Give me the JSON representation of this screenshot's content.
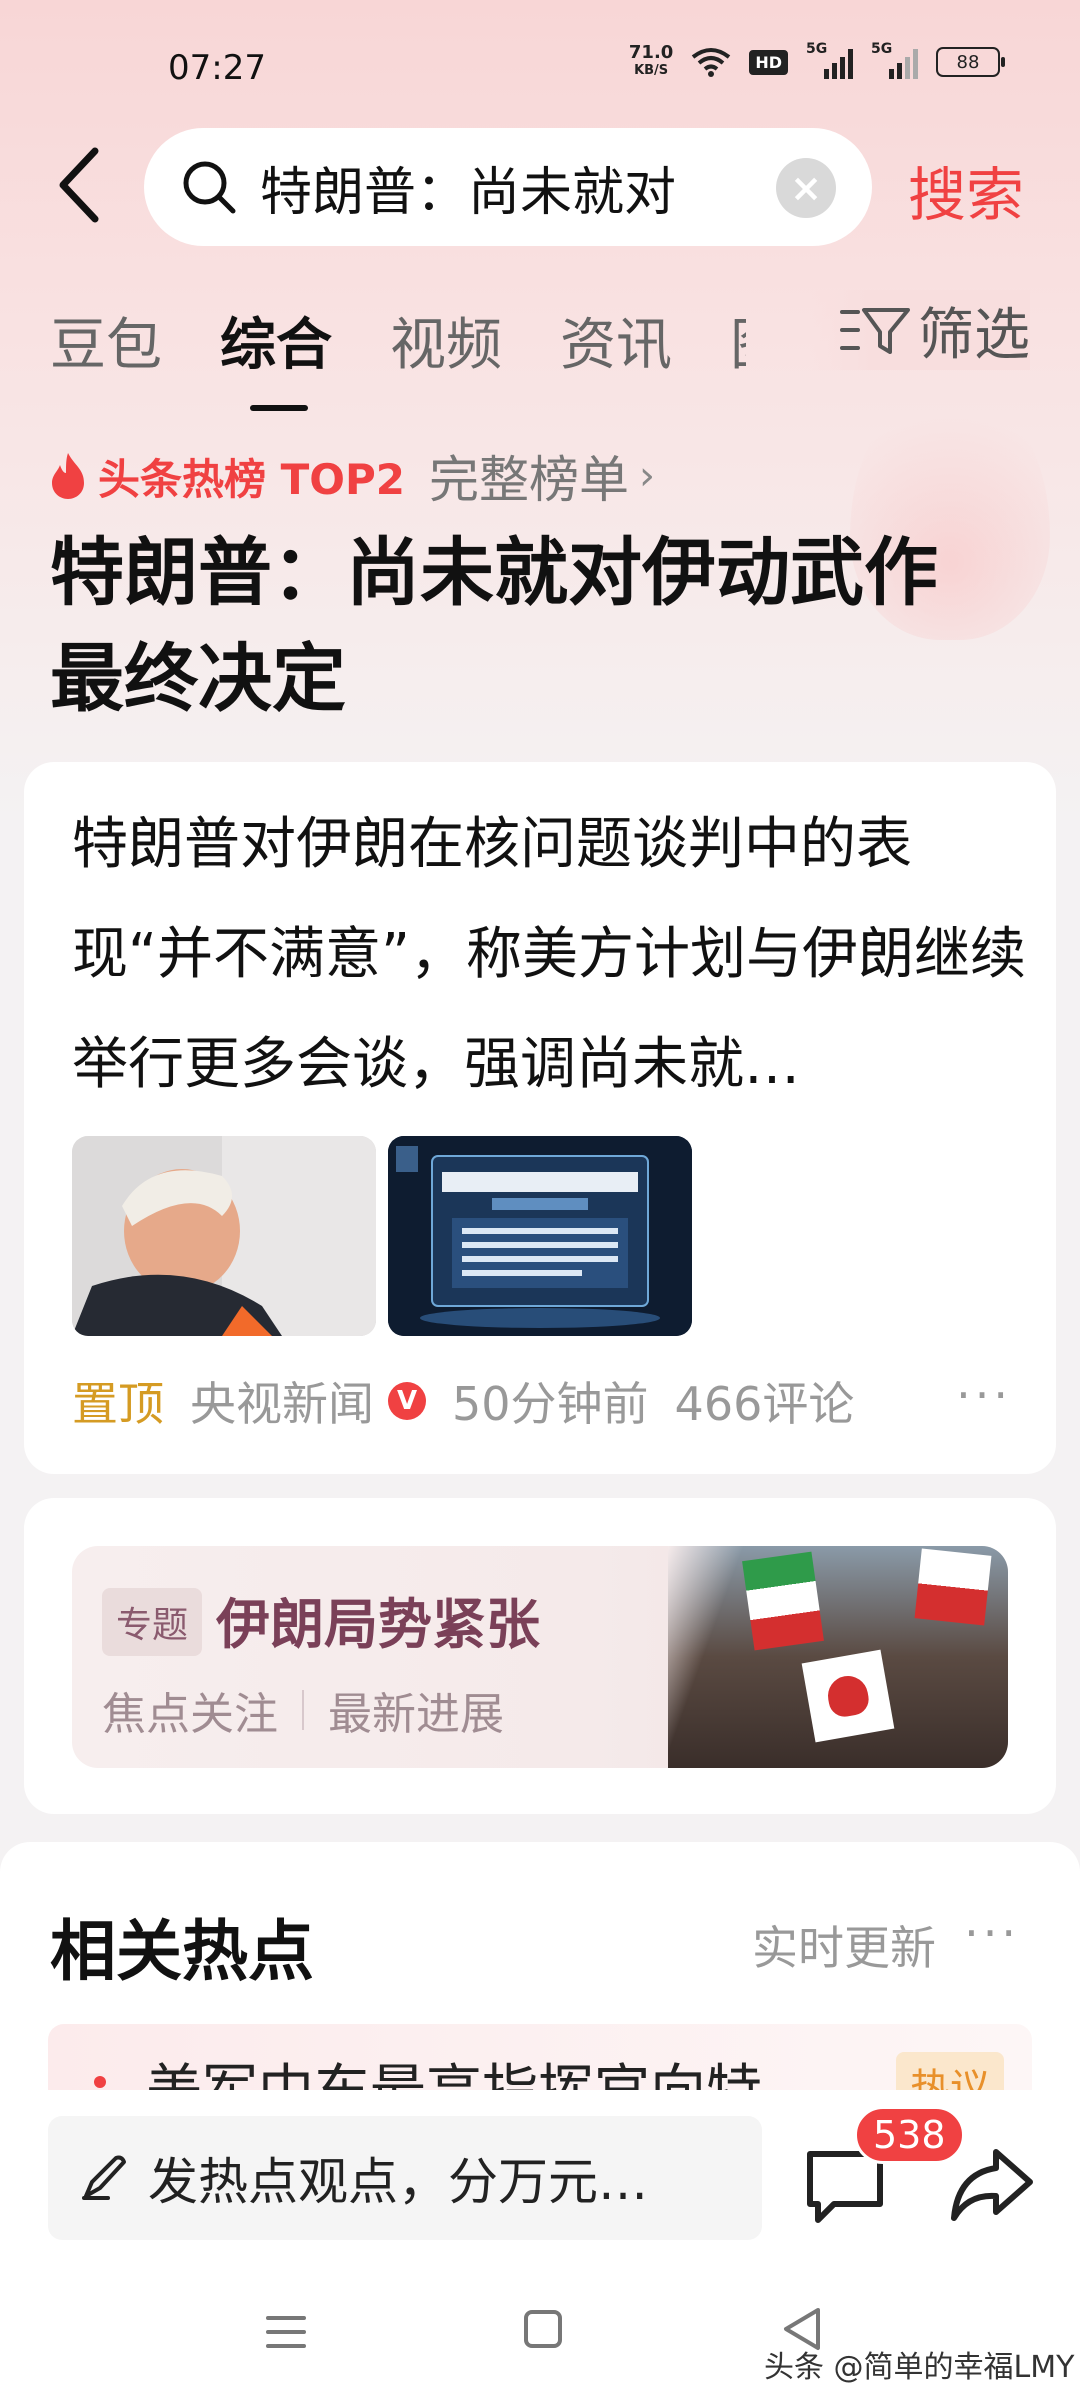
{
  "status_bar": {
    "time": "07:27",
    "speed_value": "71.0",
    "speed_unit": "KB/S",
    "hd_label": "HD",
    "signal1_label": "5G",
    "signal2_label": "5G",
    "battery": "88"
  },
  "search": {
    "query": "特朗普：尚未就对",
    "submit_label": "搜索"
  },
  "tabs": [
    {
      "label": "豆包"
    },
    {
      "label": "综合"
    },
    {
      "label": "视频"
    },
    {
      "label": "资讯"
    },
    {
      "label": "图"
    }
  ],
  "filter_label": "筛选",
  "hot_list": {
    "label": "头条热榜 TOP2",
    "full_list_label": "完整榜单",
    "chevron": "›"
  },
  "headline": "特朗普：尚未就对伊动武作最终决定",
  "article": {
    "summary": "特朗普对伊朗在核问题谈判中的表现“并不满意”，称美方计划与伊朗继续举行更多会谈，强调尚未就…",
    "pinned_label": "置顶",
    "source": "央视新闻",
    "verified_badge": "V",
    "time_ago": "50分钟前",
    "comments": "466评论",
    "more": "···"
  },
  "topic": {
    "tag": "专题",
    "title": "伊朗局势紧张",
    "links": [
      "焦点关注",
      "最新进展"
    ]
  },
  "related": {
    "title": "相关热点",
    "live_label": "实时更新",
    "more": "···",
    "items": [
      {
        "text": "美军中东最高指挥官向特",
        "badge": "热议"
      }
    ]
  },
  "comment_bar": {
    "placeholder": "发热点观点，分万元…",
    "comment_count": "538"
  },
  "watermark": "头条 @简单的幸福LMY",
  "colors": {
    "accent": "#f04142",
    "pinned": "#d59b23",
    "topic": "#7a4058"
  }
}
